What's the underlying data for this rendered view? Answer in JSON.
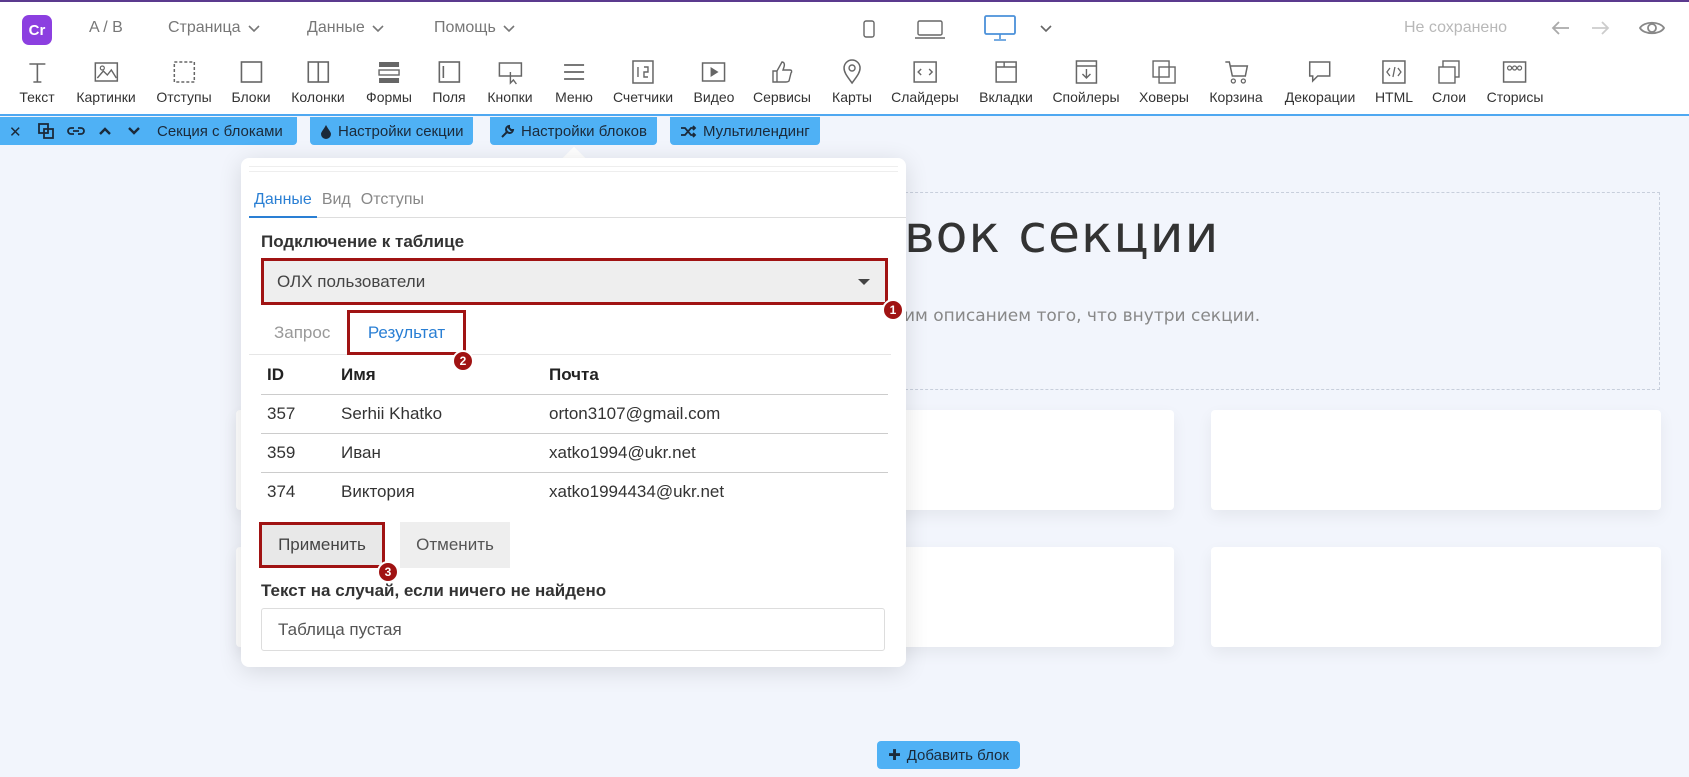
{
  "topbar": {
    "logo_text": "Cr",
    "ab_label": "A / B",
    "menus": [
      "Страница",
      "Данные",
      "Помощь"
    ],
    "status": "Не сохранено",
    "devices": [
      "mobile-icon",
      "laptop-icon",
      "desktop-icon"
    ],
    "accent_color": "#4fa8f1"
  },
  "toolbar": {
    "tools": [
      "Текст",
      "Картинки",
      "Отступы",
      "Блоки",
      "Колонки",
      "Формы",
      "Поля",
      "Кнопки",
      "Меню",
      "Счетчики",
      "Видео",
      "Сервисы",
      "Карты",
      "Слайдеры",
      "Вкладки",
      "Спойлеры",
      "Ховеры",
      "Корзина",
      "Декорации",
      "HTML",
      "Слои",
      "Сторисы"
    ]
  },
  "sectionbar": {
    "section_label": "Секция с блоками",
    "section_settings": "Настройки секции",
    "block_settings": "Настройки блоков",
    "multilanding": "Мультилендинг"
  },
  "canvas": {
    "title_fragment": "вок секции",
    "subtitle_fragment": "им описанием того, что внутри секции.",
    "add_block": "Добавить блок"
  },
  "panel": {
    "tabs": [
      "Данные",
      "Вид",
      "Отступы"
    ],
    "active_tab": "Данные",
    "table_label": "Подключение к таблице",
    "table_value": "ОЛХ пользователи",
    "query_tabs": [
      "Запрос",
      "Результат"
    ],
    "results": {
      "headers": [
        "ID",
        "Имя",
        "Почта"
      ],
      "rows": [
        [
          "357",
          "Serhii Khatko",
          "orton3107@gmail.com"
        ],
        [
          "359",
          "Иван",
          "xatko1994@ukr.net"
        ],
        [
          "374",
          "Виктория",
          "xatko1994434@ukr.net"
        ]
      ]
    },
    "apply": "Применить",
    "cancel": "Отменить",
    "empty_label": "Текст на случай, если ничего не найдено",
    "empty_value": "Таблица пустая",
    "badges": [
      "1",
      "2",
      "3"
    ],
    "highlight_color": "#a01313"
  }
}
